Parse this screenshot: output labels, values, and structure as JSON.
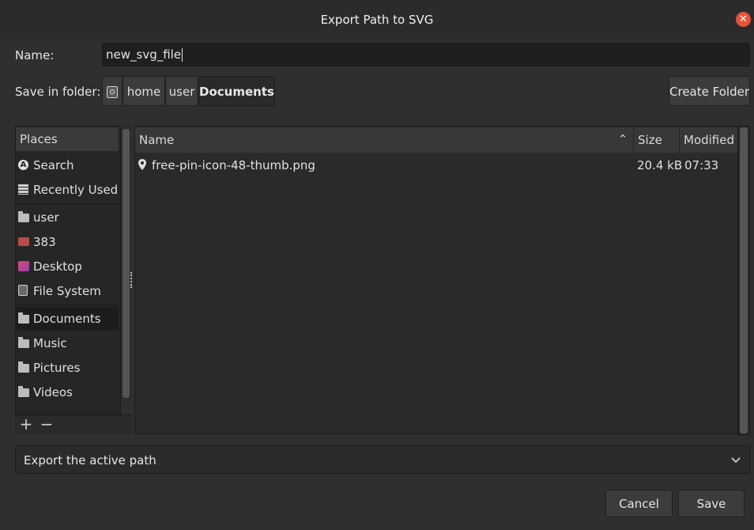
{
  "window": {
    "title": "Export Path to SVG",
    "close_icon": "close-icon",
    "accent_close": "#e6533a"
  },
  "name_row": {
    "label": "Name:",
    "value": "new_svg_file"
  },
  "folder_row": {
    "label": "Save in folder:",
    "crumbs": [
      "home",
      "user",
      "Documents"
    ],
    "root_icon": "drive-icon",
    "create_folder": "Create Folder"
  },
  "places": {
    "header": "Places",
    "items": [
      {
        "label": "Search",
        "icon": "search-icon"
      },
      {
        "label": "Recently Used",
        "icon": "recent-icon"
      },
      {
        "label": "user",
        "icon": "folder-icon"
      },
      {
        "label": "383",
        "icon": "drive-red-icon"
      },
      {
        "label": "Desktop",
        "icon": "desktop-icon"
      },
      {
        "label": "File System",
        "icon": "drive-icon"
      },
      {
        "label": "Documents",
        "icon": "folder-icon",
        "selected": true
      },
      {
        "label": "Music",
        "icon": "folder-icon"
      },
      {
        "label": "Pictures",
        "icon": "folder-icon"
      },
      {
        "label": "Videos",
        "icon": "folder-icon"
      }
    ],
    "add_label": "+",
    "remove_label": "−"
  },
  "files": {
    "columns": [
      "Name",
      "Size",
      "Modified"
    ],
    "rows": [
      {
        "name": "free-pin-icon-48-thumb.png",
        "size": "20.4 kB",
        "modified": "07:33",
        "icon": "pin-icon"
      }
    ]
  },
  "file_type": {
    "value": "Export the active path",
    "icon": "chevron-down-icon"
  },
  "actions": {
    "cancel": "Cancel",
    "save": "Save"
  }
}
